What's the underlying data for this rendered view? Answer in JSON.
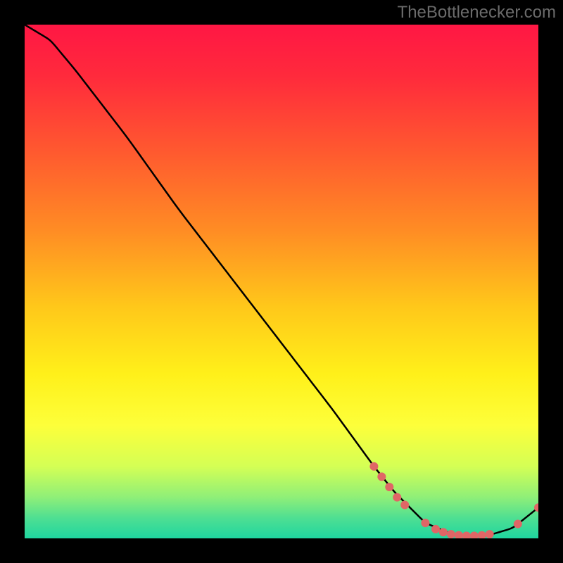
{
  "watermark": "TheBottlenecker.com",
  "chart_data": {
    "type": "line",
    "title": "",
    "xlabel": "",
    "ylabel": "",
    "xlim": [
      0,
      100
    ],
    "ylim": [
      0,
      100
    ],
    "curve": [
      {
        "x": 0,
        "y": 100
      },
      {
        "x": 5,
        "y": 97
      },
      {
        "x": 10,
        "y": 91
      },
      {
        "x": 20,
        "y": 78
      },
      {
        "x": 30,
        "y": 64
      },
      {
        "x": 40,
        "y": 51
      },
      {
        "x": 50,
        "y": 38
      },
      {
        "x": 60,
        "y": 25
      },
      {
        "x": 68,
        "y": 14
      },
      {
        "x": 72,
        "y": 9
      },
      {
        "x": 78,
        "y": 3
      },
      {
        "x": 84,
        "y": 0.5
      },
      {
        "x": 90,
        "y": 0.5
      },
      {
        "x": 95,
        "y": 2
      },
      {
        "x": 100,
        "y": 6
      }
    ],
    "highlight_points": [
      {
        "x": 68,
        "y": 14
      },
      {
        "x": 69.5,
        "y": 12
      },
      {
        "x": 71,
        "y": 10
      },
      {
        "x": 72.5,
        "y": 8
      },
      {
        "x": 74,
        "y": 6.5
      },
      {
        "x": 78,
        "y": 3
      },
      {
        "x": 80,
        "y": 1.8
      },
      {
        "x": 81.5,
        "y": 1.2
      },
      {
        "x": 83,
        "y": 0.8
      },
      {
        "x": 84.5,
        "y": 0.6
      },
      {
        "x": 86,
        "y": 0.5
      },
      {
        "x": 87.5,
        "y": 0.5
      },
      {
        "x": 89,
        "y": 0.6
      },
      {
        "x": 90.5,
        "y": 0.8
      },
      {
        "x": 96,
        "y": 2.8
      },
      {
        "x": 100,
        "y": 6
      }
    ],
    "gradient_stops": [
      {
        "offset": 0.0,
        "color": "#ff1744"
      },
      {
        "offset": 0.1,
        "color": "#ff2a3c"
      },
      {
        "offset": 0.25,
        "color": "#ff5a2f"
      },
      {
        "offset": 0.4,
        "color": "#ff8c24"
      },
      {
        "offset": 0.55,
        "color": "#ffc81a"
      },
      {
        "offset": 0.68,
        "color": "#fff01a"
      },
      {
        "offset": 0.78,
        "color": "#fdff3a"
      },
      {
        "offset": 0.86,
        "color": "#d4ff55"
      },
      {
        "offset": 0.92,
        "color": "#8fef78"
      },
      {
        "offset": 0.96,
        "color": "#4fdf92"
      },
      {
        "offset": 1.0,
        "color": "#1fd6a0"
      }
    ],
    "point_color": "#e06666",
    "line_color": "#000000"
  }
}
